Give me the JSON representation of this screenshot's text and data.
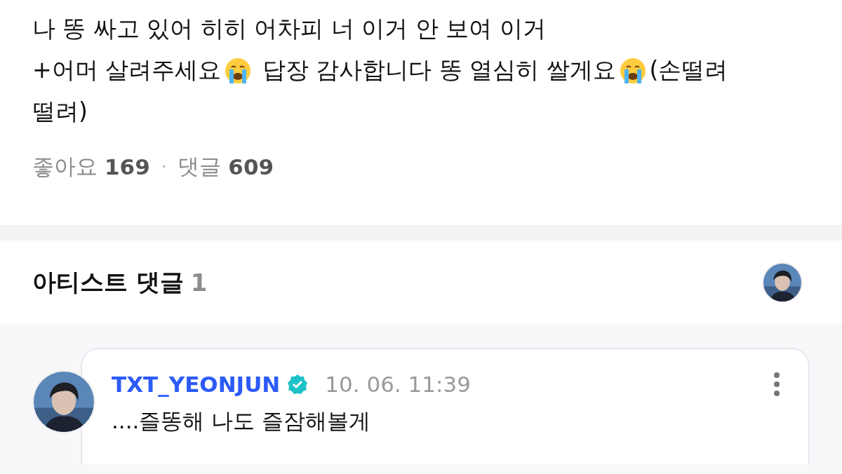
{
  "post": {
    "lines": [
      [
        {
          "kind": "text",
          "text": "나 똥 싸고 있어 히히 어차피 너 이거 안 보여 이거"
        }
      ],
      [
        {
          "kind": "text",
          "text": "+어머 살려주세요"
        },
        {
          "kind": "emoji"
        },
        {
          "kind": "text",
          "text": " 답장 감사합니다 똥 열심히 쌀게요"
        },
        {
          "kind": "emoji"
        },
        {
          "kind": "text",
          "text": "(손떨려"
        }
      ],
      [
        {
          "kind": "text",
          "text": "떨려)"
        }
      ]
    ],
    "stats": [
      {
        "label": "좋아요",
        "count": "169"
      },
      {
        "label": "댓글",
        "count": "609"
      }
    ],
    "separator": "·"
  },
  "artist_comments": {
    "title": "아티스트 댓글",
    "count": "1",
    "comments": [
      {
        "author": "TXT_YEONJUN",
        "verified": true,
        "time": "10. 06. 11:39",
        "text": "....즐똥해 나도 즐잠해볼게"
      }
    ]
  }
}
